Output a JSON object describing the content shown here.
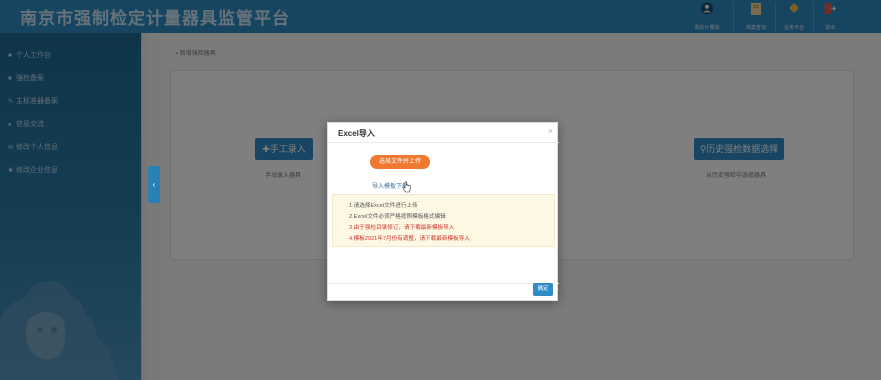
{
  "app": {
    "title": "南京市强制检定计量器具监管平台"
  },
  "header_buttons": [
    {
      "label": "我的计量院",
      "icon": "user-circle-icon"
    },
    {
      "label": "档案查询",
      "icon": "folder-icon"
    },
    {
      "label": "业务平台",
      "icon": "diamond-icon"
    },
    {
      "label": "退出",
      "icon": "exit-icon"
    }
  ],
  "sidebar": {
    "items": [
      {
        "label": "个人工作台",
        "icon": "home-icon"
      },
      {
        "label": "强检备案",
        "icon": "file-icon"
      },
      {
        "label": "主标准器备案",
        "icon": "wrench-icon"
      },
      {
        "label": "信息交流",
        "icon": "chat-icon"
      },
      {
        "label": "修改个人信息",
        "icon": "edit-icon"
      },
      {
        "label": "修改企业信息",
        "icon": "gear-icon"
      }
    ]
  },
  "main": {
    "breadcrumb": "新增强检器具",
    "manual_button": "手工录入",
    "manual_caption": "手动录入器具",
    "history_button": "历史强检数据选择",
    "history_caption": "从历史强检中选择器具"
  },
  "modal": {
    "title": "Excel导入",
    "close": "×",
    "upload_button": "选择文件并上传",
    "template_link": "导入模板下载",
    "notes": [
      {
        "text": "1.请选择Excel文件进行上传",
        "color": "#555555"
      },
      {
        "text": "2.Excel文件必须严格按照模板格式编辑",
        "color": "#555555"
      },
      {
        "text": "3.由于强检目录修订，请下载最新模板导入",
        "color": "#d0342c"
      },
      {
        "text": "4.模板2021年7月份有调整，请下载最新模板导入",
        "color": "#d0342c"
      }
    ],
    "ok_button": "确定"
  },
  "colors": {
    "header": "#2a8ac0",
    "accent": "#2e8bc6",
    "upload": "#f0782f",
    "warning": "#d0342c"
  }
}
